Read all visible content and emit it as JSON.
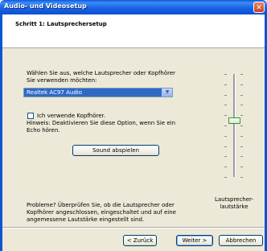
{
  "window": {
    "title": "Audio- und Videosetup",
    "close_label": "✕"
  },
  "header": {
    "step_title": "Schritt 1: Lautsprechersetup"
  },
  "main": {
    "select_prompt": "Wählen Sie aus, welche Lautsprecher oder Kopfhörer Sie verwenden möchten:",
    "device_select": {
      "value": "Realtek AC97 Audio",
      "arrow": "▼"
    },
    "headphones_checkbox": {
      "label": "Ich verwende Kopfhörer.",
      "checked": false
    },
    "hint_text": "Hinweis: Deaktivieren Sie diese Option, wenn Sie ein Echo hören.",
    "play_sound_label": "Sound abspielen",
    "problems_text": "Probleme? Überprüfen Sie, ob die Lautsprecher oder Kopfhörer angeschlossen, eingeschaltet und auf eine angemessene Lautstärke eingestellt sind."
  },
  "volume": {
    "label": "Lautsprecher-\nlautstärke",
    "level_fraction": 0.55
  },
  "footer": {
    "back_label": "< Zurück",
    "next_label": "Weiter >",
    "cancel_label": "Abbrechen"
  }
}
